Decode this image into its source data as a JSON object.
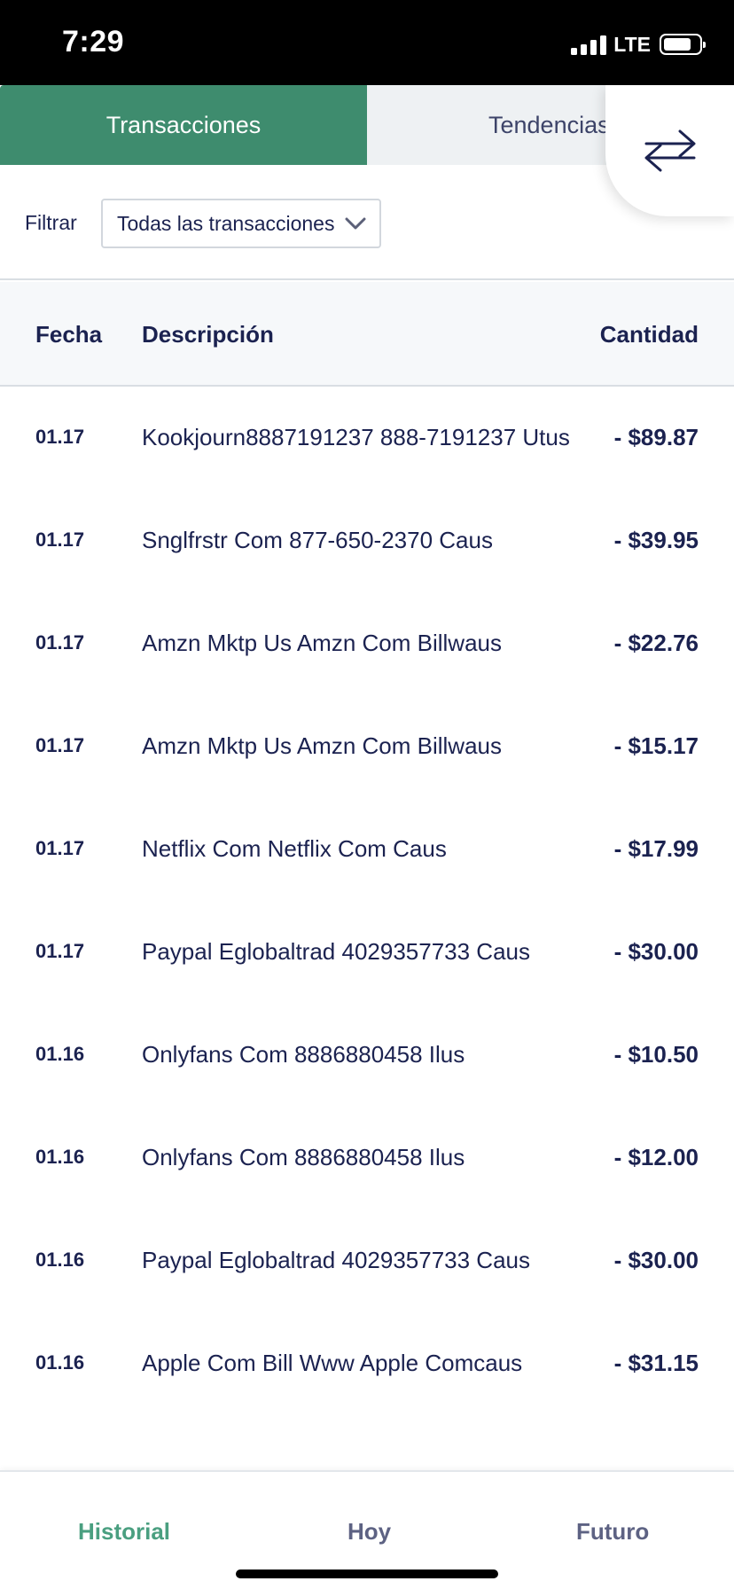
{
  "status_bar": {
    "time": "7:29",
    "network": "LTE",
    "icons": [
      "signal-icon",
      "battery-icon"
    ]
  },
  "tabs": [
    {
      "label": "Transacciones",
      "active": true
    },
    {
      "label": "Tendencias",
      "active": false
    }
  ],
  "swap_button": {
    "icon": "swap-arrows-icon"
  },
  "filter": {
    "label": "Filtrar",
    "selected": "Todas las transacciones",
    "icon": "chevron-down-icon"
  },
  "table": {
    "headers": {
      "date": "Fecha",
      "description": "Descripción",
      "amount": "Cantidad"
    },
    "rows": [
      {
        "date": "01.17",
        "description": "Kookjourn8887191237 888-7191237 Utus",
        "amount": "- $89.87"
      },
      {
        "date": "01.17",
        "description": "Snglfrstr Com 877-650-2370 Caus",
        "amount": "- $39.95"
      },
      {
        "date": "01.17",
        "description": "Amzn Mktp Us Amzn Com Billwaus",
        "amount": "- $22.76"
      },
      {
        "date": "01.17",
        "description": "Amzn Mktp Us Amzn Com Billwaus",
        "amount": "- $15.17"
      },
      {
        "date": "01.17",
        "description": "Netflix Com Netflix Com Caus",
        "amount": "- $17.99"
      },
      {
        "date": "01.17",
        "description": "Paypal Eglobaltrad 4029357733 Caus",
        "amount": "- $30.00"
      },
      {
        "date": "01.16",
        "description": "Onlyfans Com 8886880458 Ilus",
        "amount": "- $10.50"
      },
      {
        "date": "01.16",
        "description": "Onlyfans Com 8886880458 Ilus",
        "amount": "- $12.00"
      },
      {
        "date": "01.16",
        "description": "Paypal Eglobaltrad 4029357733 Caus",
        "amount": "- $30.00"
      },
      {
        "date": "01.16",
        "description": "Apple Com Bill Www Apple Comcaus",
        "amount": "- $31.15"
      }
    ]
  },
  "bottom_nav": {
    "items": [
      {
        "label": "Historial",
        "active": true
      },
      {
        "label": "Hoy",
        "active": false
      },
      {
        "label": "Futuro",
        "active": false
      }
    ]
  },
  "colors": {
    "accent_green": "#3e8c6e",
    "text_navy": "#1b2250",
    "nav_active": "#4a9f80"
  }
}
